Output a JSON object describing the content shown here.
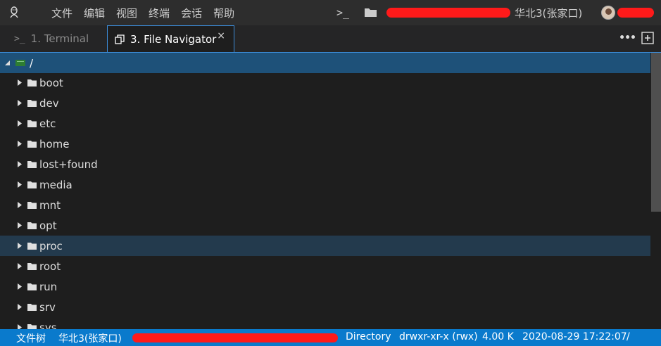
{
  "menubar": {
    "app_icon": "linux-penguin-icon",
    "items": [
      "文件",
      "编辑",
      "视图",
      "终端",
      "会话",
      "帮助"
    ],
    "terminal_icon": "terminal-prompt-icon",
    "server_folder_icon": "folder-icon",
    "server_label": "华北3(张家口)"
  },
  "tabs": {
    "items": [
      {
        "label": "1. Terminal",
        "icon": "terminal-prompt-icon"
      },
      {
        "label": "3. File Navigator",
        "icon": "copy-icon",
        "close": "×"
      }
    ],
    "more_icon": "ellipsis-icon",
    "add_icon": "plus-square-icon"
  },
  "tree": {
    "root": "/",
    "items": [
      "boot",
      "dev",
      "etc",
      "home",
      "lost+found",
      "media",
      "mnt",
      "opt",
      "proc",
      "root",
      "run",
      "srv",
      "sys"
    ],
    "hovered": "proc"
  },
  "statusbar": {
    "file_tree": "文件树",
    "region": "华北3(张家口)",
    "type": "Directory",
    "permissions": "drwxr-xr-x (rwx)",
    "size": "4.00 K",
    "modified": "2020-08-29 17:22:07",
    "path": "/"
  },
  "colors": {
    "accent": "#3c8cd8",
    "status_bar": "#0a7acc",
    "selected_row": "#1e5179",
    "redaction": "#ff1a1a"
  }
}
